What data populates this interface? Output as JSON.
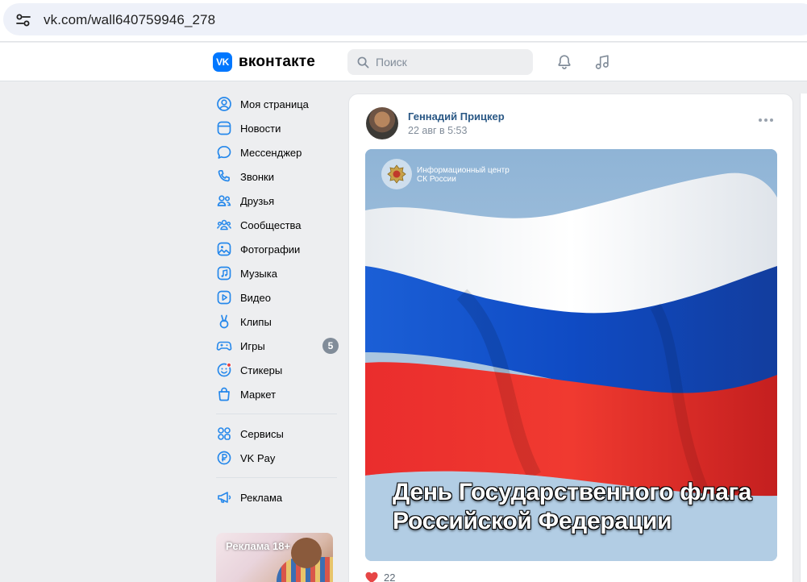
{
  "browser": {
    "url": "vk.com/wall640759946_278"
  },
  "header": {
    "logo_text": "вконтакте",
    "logo_mark": "VK",
    "search_placeholder": "Поиск",
    "icons": [
      "bell-icon",
      "music-note-icon"
    ]
  },
  "menu": {
    "items": [
      {
        "label": "Моя страница",
        "icon": "profile-icon"
      },
      {
        "label": "Новости",
        "icon": "news-icon"
      },
      {
        "label": "Мессенджер",
        "icon": "messenger-icon"
      },
      {
        "label": "Звонки",
        "icon": "phone-icon"
      },
      {
        "label": "Друзья",
        "icon": "friends-icon"
      },
      {
        "label": "Сообщества",
        "icon": "communities-icon"
      },
      {
        "label": "Фотографии",
        "icon": "photos-icon"
      },
      {
        "label": "Музыка",
        "icon": "music-icon"
      },
      {
        "label": "Видео",
        "icon": "video-icon"
      },
      {
        "label": "Клипы",
        "icon": "clips-icon"
      },
      {
        "label": "Игры",
        "icon": "games-icon",
        "badge": "5"
      },
      {
        "label": "Стикеры",
        "icon": "stickers-icon"
      },
      {
        "label": "Маркет",
        "icon": "market-icon"
      }
    ],
    "secondary": [
      {
        "label": "Сервисы",
        "icon": "services-icon"
      },
      {
        "label": "VK Pay",
        "icon": "vkpay-icon"
      }
    ],
    "tertiary": [
      {
        "label": "Реклама",
        "icon": "megaphone-icon"
      }
    ]
  },
  "ad": {
    "label": "Реклама 18+"
  },
  "post": {
    "author": "Геннадий Прицкер",
    "date": "22 авг в 5:53",
    "image": {
      "org_line1": "Информационный центр",
      "org_line2": "СК России",
      "caption_line1": "День Государственного флага",
      "caption_line2": "Российской Федерации"
    },
    "likes": "22"
  },
  "colors": {
    "accent": "#0077ff",
    "link": "#2a5885",
    "icon": "#2688eb",
    "secondary_text": "#818c99",
    "like": "#e64646",
    "background": "#edeef0"
  }
}
